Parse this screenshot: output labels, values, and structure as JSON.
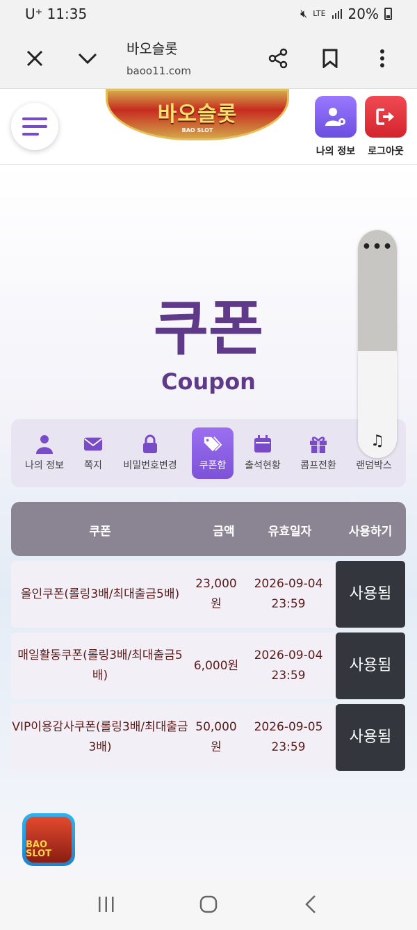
{
  "status": {
    "carrier": "U⁺",
    "time": "11:35",
    "network": "LTE",
    "battery": "20%"
  },
  "browser": {
    "title": "바오슬롯",
    "url": "baoo11.com"
  },
  "header": {
    "logo": {
      "text": "바오슬롯",
      "sub": "BAO SLOT"
    },
    "my_info_label": "나의 정보",
    "logout_label": "로그아웃",
    "colors": {
      "my_info": "#7e57e0",
      "logout": "#e0303a"
    }
  },
  "page": {
    "title": "쿠폰",
    "subtitle": "Coupon"
  },
  "nav": {
    "items": [
      {
        "label": "나의 정보",
        "icon": "user-icon"
      },
      {
        "label": "쪽지",
        "icon": "envelope-icon"
      },
      {
        "label": "비밀번호변경",
        "icon": "lock-icon"
      },
      {
        "label": "쿠폰함",
        "icon": "coupon-tag-icon",
        "active": true
      },
      {
        "label": "출석현황",
        "icon": "calendar-icon"
      },
      {
        "label": "콤프전환",
        "icon": "gift-icon"
      },
      {
        "label": "랜덤박스",
        "icon": "box-icon"
      }
    ]
  },
  "float_widget": {
    "dots": "•••",
    "sound": "♫"
  },
  "table": {
    "headers": [
      "쿠폰",
      "금액",
      "유효일자",
      "사용하기"
    ],
    "rows": [
      {
        "name": "올인쿠폰(롤링3배/최대출금5배)",
        "amount": "23,000원",
        "date": "2026-09-04",
        "time": "23:59",
        "action": "사용됨"
      },
      {
        "name": "매일활동쿠폰(롤링3배/최대출금5배)",
        "amount": "6,000원",
        "date": "2026-09-04",
        "time": "23:59",
        "action": "사용됨"
      },
      {
        "name": "VIP이용감사쿠폰(롤링3배/최대출금3배)",
        "amount": "50,000원",
        "date": "2026-09-05",
        "time": "23:59",
        "action": "사용됨"
      }
    ]
  },
  "app_badge": {
    "text": "BAO SLOT"
  }
}
